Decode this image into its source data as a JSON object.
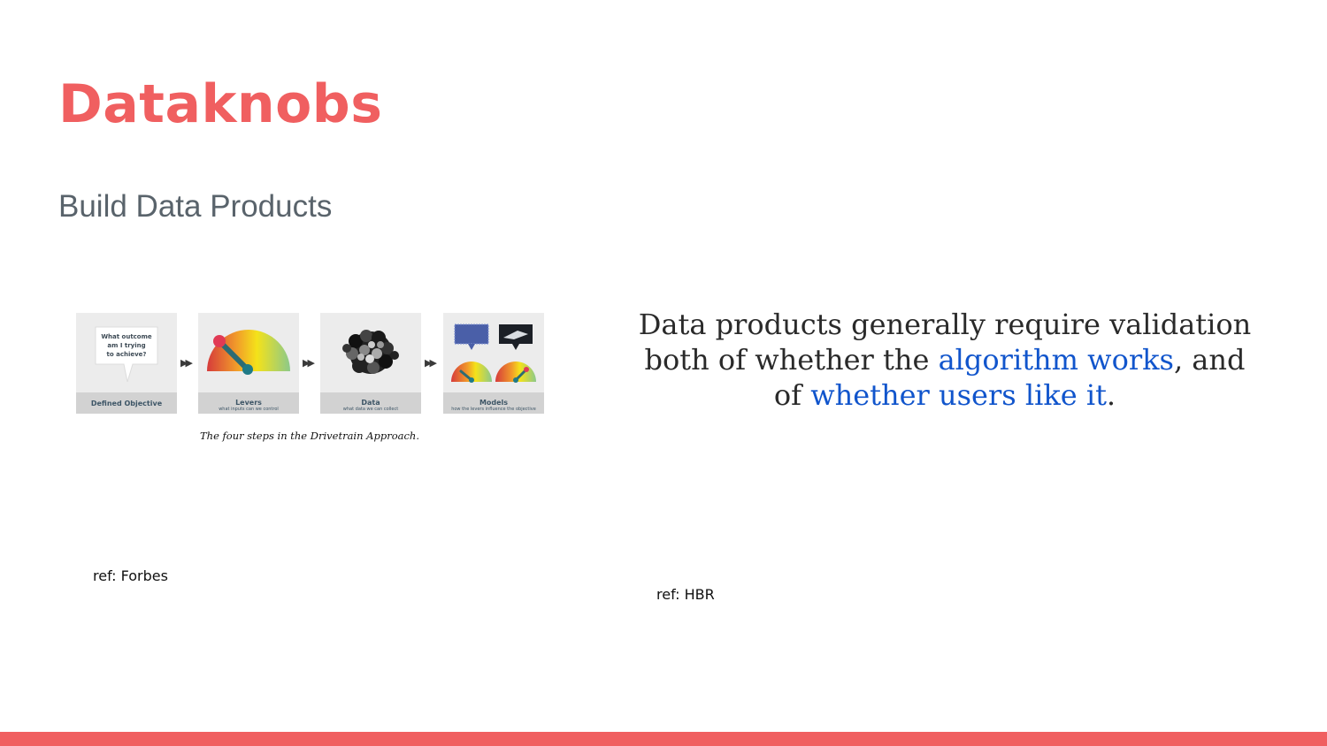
{
  "slide": {
    "title": "Dataknobs",
    "subtitle": "Build Data Products"
  },
  "diagram": {
    "caption": "The four steps in the Drivetrain Approach.",
    "question": [
      "What outcome",
      "am I trying",
      "to achieve?"
    ],
    "steps": [
      {
        "label": "Defined Objective",
        "sublabel": ""
      },
      {
        "label": "Levers",
        "sublabel": "what inputs can we control"
      },
      {
        "label": "Data",
        "sublabel": "what data we can collect"
      },
      {
        "label": "Models",
        "sublabel": "how the levers influence the objective"
      }
    ],
    "arrow_glyph": "▶▶"
  },
  "quote": {
    "part1": "Data products generally require validation both of whether the ",
    "link1": "algorithm works",
    "part2": ", and of ",
    "link2": "whether users like it",
    "part3": "."
  },
  "refs": {
    "left": "ref: Forbes",
    "right": "ref: HBR"
  },
  "colors": {
    "accent": "#f05f60",
    "subtitle": "#59636b",
    "link": "#1155cc"
  }
}
